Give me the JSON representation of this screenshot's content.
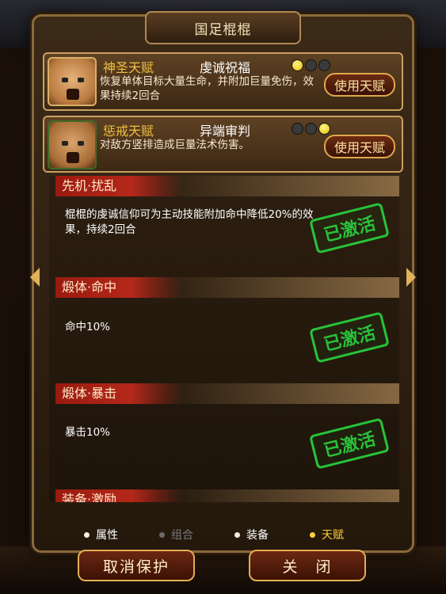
{
  "window": {
    "title": "国足棍棍"
  },
  "talents": [
    {
      "name": "神圣天赋",
      "skill": "虔诚祝福",
      "desc": "恢复单体目标大量生命，并附加巨量免伤，效果持续2回合",
      "button": "使用天赋",
      "dots": [
        true,
        false,
        false
      ]
    },
    {
      "name": "惩戒天赋",
      "skill": "异端审判",
      "desc": "对敌方竖排造成巨量法术伤害。",
      "button": "使用天赋",
      "dots": [
        false,
        false,
        true
      ]
    }
  ],
  "passives": [
    {
      "title": "先机·扰乱",
      "desc": "棍棍的虔诚信仰可为主动技能附加命中降低20%的效果，持续2回合",
      "stamp": "已激活"
    },
    {
      "title": "煅体·命中",
      "desc": "命中10%",
      "stamp": "已激活"
    },
    {
      "title": "煅体·暴击",
      "desc": "暴击10%",
      "stamp": "已激活"
    },
    {
      "title": "装备·激励",
      "desc": "",
      "stamp": ""
    }
  ],
  "tabs": [
    {
      "label": "属性",
      "state": "normal"
    },
    {
      "label": "组合",
      "state": "disabled"
    },
    {
      "label": "装备",
      "state": "normal"
    },
    {
      "label": "天赋",
      "state": "active"
    }
  ],
  "buttons": {
    "cancel": "取消保护",
    "close": "关　闭"
  },
  "colors": {
    "accent": "#f0c040",
    "stamp": "#27c43a",
    "section_red": "#b4281a"
  }
}
